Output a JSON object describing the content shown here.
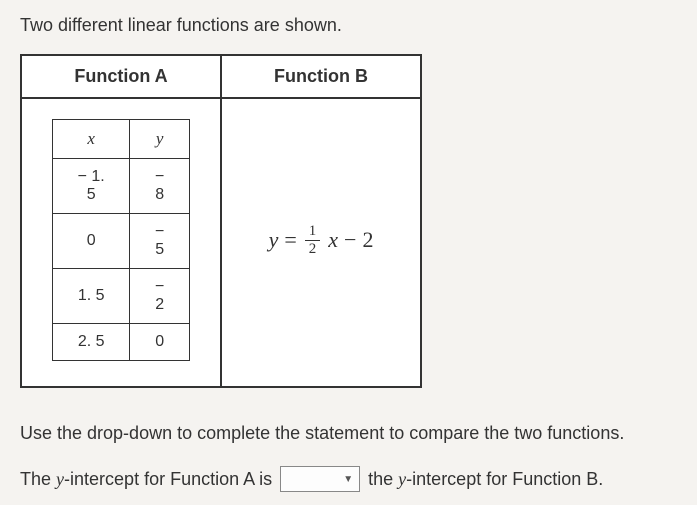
{
  "intro": "Two different linear functions are shown.",
  "headers": {
    "a": "Function A",
    "b": "Function B"
  },
  "functionA": {
    "xHeader": "x",
    "yHeader": "y",
    "rows": [
      {
        "x": "− 1. 5",
        "y": "− 8"
      },
      {
        "x": "0",
        "y": "− 5"
      },
      {
        "x": "1. 5",
        "y": "− 2"
      },
      {
        "x": "2. 5",
        "y": "0"
      }
    ]
  },
  "functionB": {
    "lhs": "y",
    "equals": "=",
    "frac_num": "1",
    "frac_den": "2",
    "xvar": "x",
    "minus": "−",
    "constant": "2"
  },
  "instruction": "Use the drop-down to complete the statement to compare the two functions.",
  "statement": {
    "part1_pre": "The ",
    "yvar1": "y",
    "part1_post": "-intercept for Function A is",
    "part2_pre": "the ",
    "yvar2": "y",
    "part2_post": "-intercept for Function B."
  },
  "chart_data": {
    "type": "table",
    "functionA_points": [
      {
        "x": -1.5,
        "y": -8
      },
      {
        "x": 0,
        "y": -5
      },
      {
        "x": 1.5,
        "y": -2
      },
      {
        "x": 2.5,
        "y": 0
      }
    ],
    "functionB_equation": "y = (1/2)x - 2",
    "functionB_slope": 0.5,
    "functionB_intercept": -2
  }
}
